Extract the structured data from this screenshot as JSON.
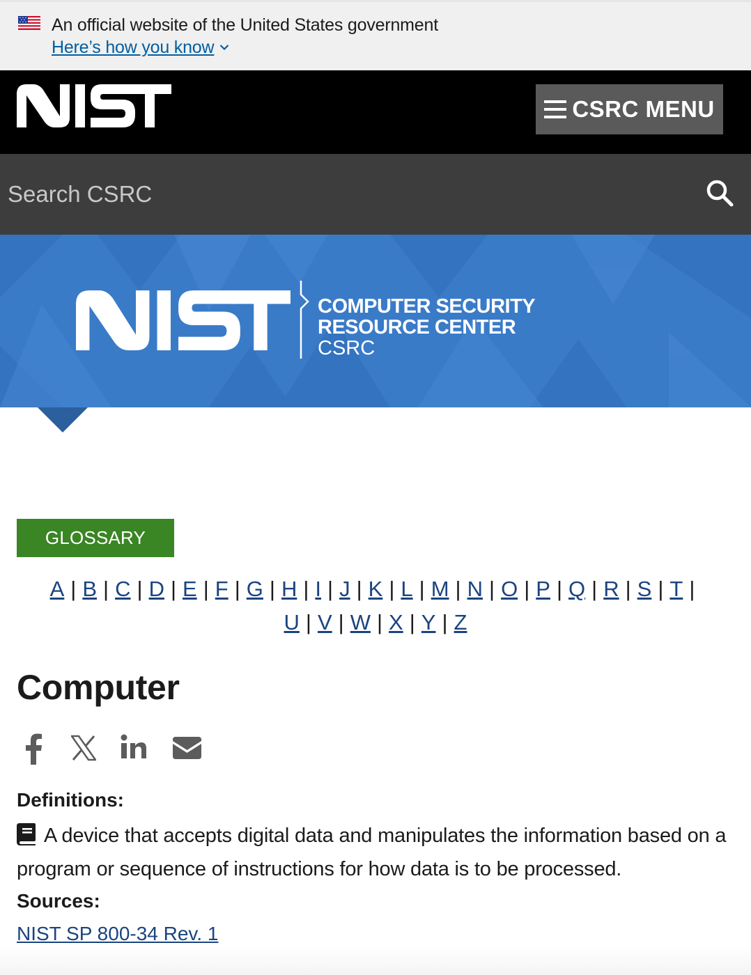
{
  "gov_banner": {
    "text": "An official website of the United States government",
    "link": "Here’s how you know"
  },
  "header": {
    "logo_text": "NIST",
    "menu_label": "CSRC MENU"
  },
  "search": {
    "placeholder": "Search CSRC"
  },
  "hero": {
    "logo_text": "NIST",
    "title_line1": "COMPUTER SECURITY",
    "title_line2": "RESOURCE CENTER",
    "subtitle": "CSRC"
  },
  "page": {
    "tag": "GLOSSARY",
    "letters_row1": [
      "A",
      "B",
      "C",
      "D",
      "E",
      "F",
      "G",
      "H",
      "I",
      "J",
      "K",
      "L",
      "M",
      "N",
      "O",
      "P",
      "Q",
      "R",
      "S",
      "T"
    ],
    "letters_row2": [
      "U",
      "V",
      "W",
      "X",
      "Y",
      "Z"
    ],
    "term": "Computer",
    "share_icons": [
      "facebook-icon",
      "x-icon",
      "linkedin-icon",
      "email-icon"
    ],
    "definitions_label": "Definitions:",
    "definition": "A device that accepts digital data and manipulates the information based on a program or sequence of instructions for how data is to be processed.",
    "sources_label": "Sources:",
    "source_link": "NIST SP 800-34 Rev. 1"
  },
  "colors": {
    "gov_link": "#005ea2",
    "hero_blue": "#3a7bc8",
    "glossary_green": "#3a8524",
    "link": "#1a4480"
  }
}
